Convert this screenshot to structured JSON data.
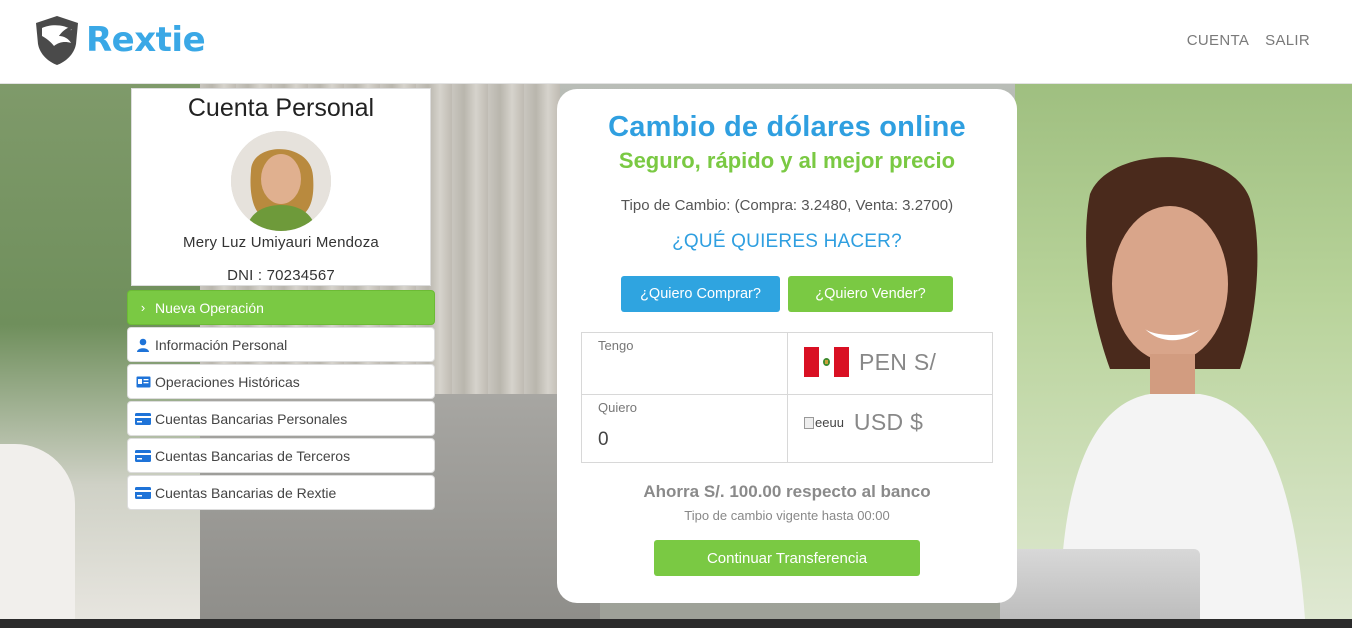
{
  "brand": {
    "name": "Rextie",
    "accent": "#3aa8e6",
    "green": "#7ac943"
  },
  "nav": {
    "items": [
      "CUENTA",
      "SALIR"
    ]
  },
  "profile": {
    "title": "Cuenta Personal",
    "name": "Mery Luz Umiyauri Mendoza",
    "dni": "DNI : 70234567"
  },
  "menu": {
    "items": [
      {
        "label": "Nueva Operación",
        "icon": "chevron-right-icon",
        "active": true
      },
      {
        "label": "Información Personal",
        "icon": "user-icon",
        "active": false
      },
      {
        "label": "Operaciones Históricas",
        "icon": "id-card-icon",
        "active": false
      },
      {
        "label": "Cuentas Bancarias Personales",
        "icon": "credit-card-icon",
        "active": false
      },
      {
        "label": "Cuentas Bancarias de Terceros",
        "icon": "credit-card-icon",
        "active": false
      },
      {
        "label": "Cuentas Bancarias de Rextie",
        "icon": "credit-card-icon",
        "active": false
      }
    ]
  },
  "exchange": {
    "title": "Cambio de dólares online",
    "subtitle": "Seguro, rápido y al mejor precio",
    "rate": "Tipo de Cambio: (Compra: 3.2480, Venta: 3.2700)",
    "question": "¿QUÉ QUIERES HACER?",
    "buy_label": "¿Quiero Comprar?",
    "sell_label": "¿Quiero Vender?",
    "have_label": "Tengo",
    "have_value": "",
    "have_currency": "PEN S/",
    "want_label": "Quiero",
    "want_value": "0",
    "want_currency": "USD $",
    "want_flag_alt": "eeuu",
    "savings": "Ahorra S/. 100.00 respecto al banco",
    "validity": "Tipo de cambio vigente hasta 00:00",
    "continue_label": "Continuar Transferencia"
  }
}
